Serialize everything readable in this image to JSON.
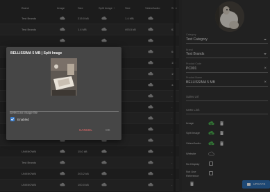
{
  "table": {
    "headers": [
      "Brand",
      "Image",
      "Size",
      "Split Image",
      "Size",
      "Video/Audio",
      "Size"
    ],
    "rows": [
      {
        "brand": "Test Brands",
        "size": "215.0 kB",
        "size2": "1.4 MB",
        "extra": ""
      },
      {
        "brand": "Test Brands",
        "size": "1.4 MB",
        "size2": "493.5 kB",
        "extra": "62."
      },
      {
        "brand": "",
        "size": "",
        "size2": "",
        "extra": ""
      },
      {
        "brand": "",
        "size": "",
        "size2": "",
        "extra": "64."
      },
      {
        "brand": "",
        "size": "",
        "size2": "",
        "extra": "115"
      },
      {
        "brand": "",
        "size": "",
        "size2": "",
        "extra": "19."
      },
      {
        "brand": "",
        "size": "",
        "size2": "",
        "extra": "44."
      },
      {
        "brand": "",
        "size": "",
        "size2": "",
        "extra": "-"
      },
      {
        "brand": "",
        "size": "",
        "size2": "",
        "extra": "-"
      },
      {
        "brand": "",
        "size": "",
        "size2": "",
        "extra": "-"
      },
      {
        "brand": "Tes",
        "size": "",
        "size2": "",
        "extra": "-"
      },
      {
        "brand": "",
        "size": "",
        "size2": "",
        "extra": "-"
      },
      {
        "brand": "UNKNOWN",
        "size": "15.0 kB",
        "size2": "",
        "extra": "-"
      },
      {
        "brand": "Test Brands",
        "size": "",
        "size2": "",
        "extra": "-"
      },
      {
        "brand": "UNKNOWN",
        "size": "203.2 kB",
        "size2": "",
        "extra": "-"
      },
      {
        "brand": "UNKNOWN",
        "size": "100.0 kB",
        "size2": "",
        "extra": "-"
      }
    ]
  },
  "panel": {
    "category_label": "Category",
    "category_value": "Test Category",
    "brand_label": "Brand",
    "brand_value": "Test Brands",
    "product_code_label": "Product Code",
    "product_code_value": "PC001",
    "product_name_label": "Product Name",
    "product_name_value": "BELLISSIMA 5 MB",
    "sales_url_label": "Sales Url",
    "cms_link_label": "CMS Link",
    "cms_items": [
      {
        "label": "Image",
        "state": "uploaded",
        "trash": true
      },
      {
        "label": "Split Image",
        "state": "uploaded",
        "trash": true
      },
      {
        "label": "Video/Audio",
        "state": "uploaded",
        "trash": true
      },
      {
        "label": "Website",
        "state": "empty",
        "trash": false
      }
    ],
    "no_display_label": "No Display",
    "not_use_label": "Not Use",
    "reference_label": "Reference",
    "update_label": "UPDATE"
  },
  "dialog": {
    "title": "BELLISSIMA 5 MB | Split Image",
    "input_placeholder": "Select an image file",
    "enabled_label": "Enabled",
    "enabled_checked": true,
    "cancel_label": "CANCEL",
    "ok_label": "OK"
  },
  "colors": {
    "accent": "#3b7fd0",
    "cancel": "#ff6e6e",
    "cloud_done": "#4caf50",
    "update_button": "#2f6fb3"
  },
  "icons": {
    "cloud": "cloud-icon",
    "cloud_done": "cloud-done-icon",
    "trash": "trash-icon",
    "clear": "clear-icon",
    "dropdown": "chevron-down-icon",
    "save": "save-icon"
  }
}
